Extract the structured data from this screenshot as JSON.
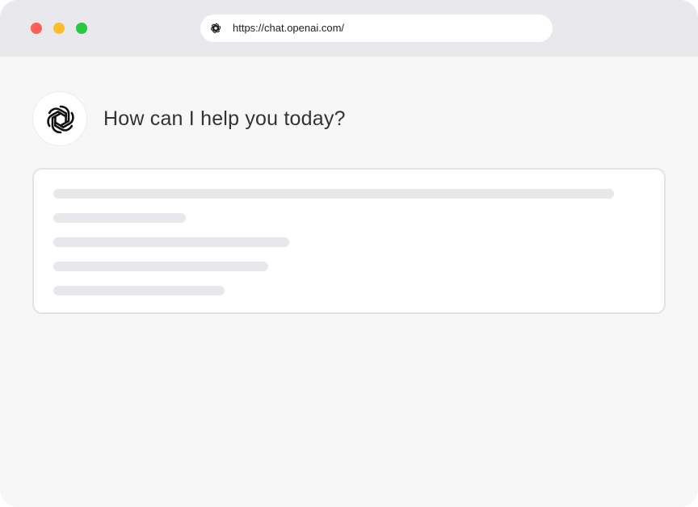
{
  "browser": {
    "url": "https://chat.openai.com/",
    "favicon_icon": "openai-logo-icon",
    "window_controls": [
      {
        "name": "close",
        "color": "#ff5f57"
      },
      {
        "name": "minimize",
        "color": "#ffbd2e"
      },
      {
        "name": "maximize",
        "color": "#28c840"
      }
    ]
  },
  "main": {
    "avatar_icon": "openai-logo-icon",
    "greeting": "How can I help you today?",
    "response_card": {
      "state": "loading",
      "placeholder_lines": 5
    }
  },
  "colors": {
    "titlebar": "#e8e8ed",
    "page_background": "#f7f7f7",
    "skeleton": "#e8e8ec"
  }
}
